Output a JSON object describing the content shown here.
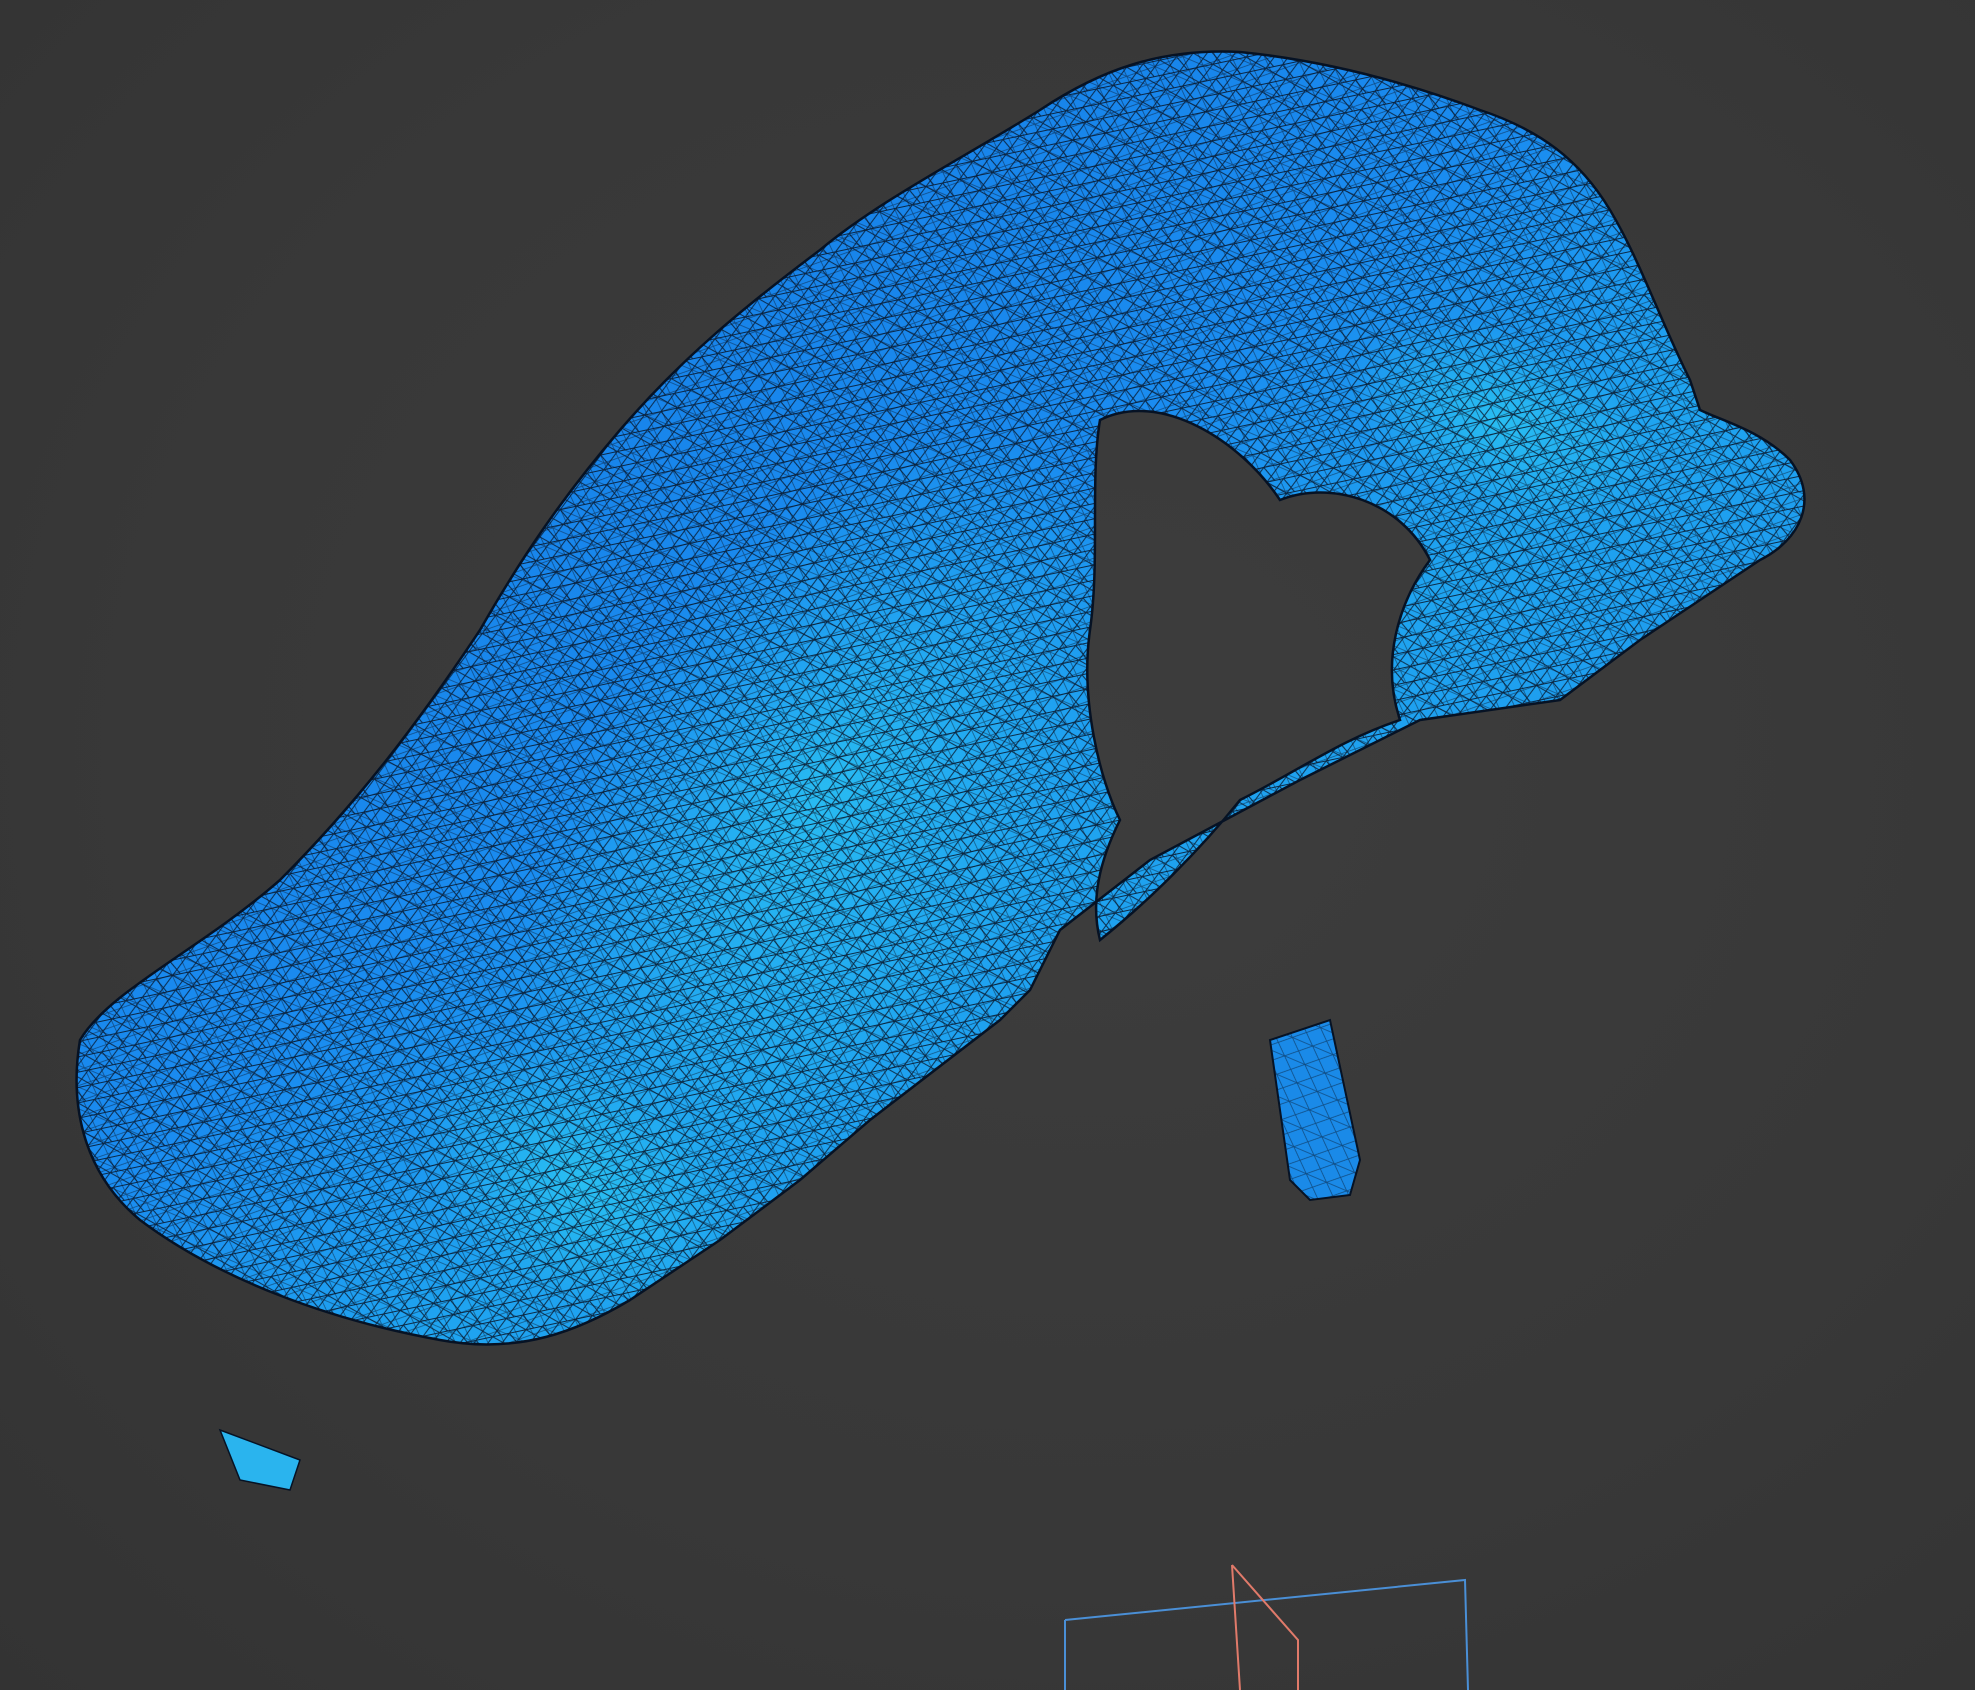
{
  "viewport": {
    "background": "#383838"
  },
  "mesh": {
    "base_color": "#1a8cf0",
    "highlight_color": "#22b8f0",
    "wire_color": "#06152a",
    "render_mode": "shaded-wireframe"
  },
  "gizmo": {
    "frame_color": "#4a8fd6",
    "plane_color": "#e07a6a"
  }
}
